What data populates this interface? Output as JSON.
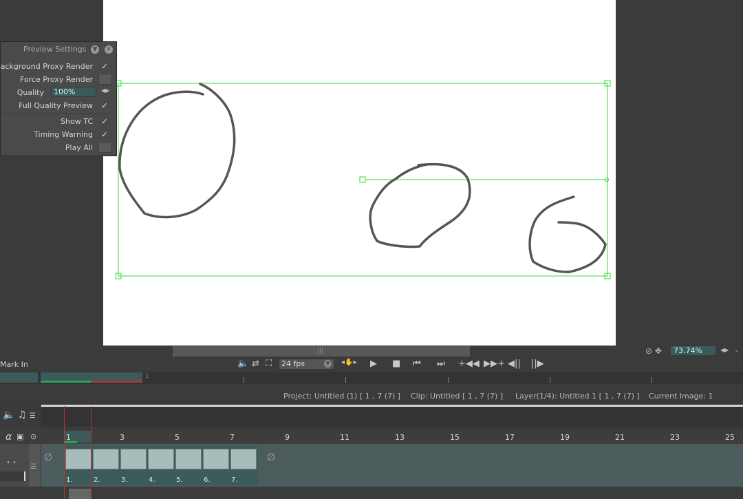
{
  "preview_settings": {
    "title": "Preview Settings",
    "background_proxy_render": {
      "label": "Background Proxy Render",
      "checked": true
    },
    "force_proxy_render": {
      "label": "Force Proxy Render",
      "checked": false
    },
    "quality": {
      "label": "Quality",
      "value": "100%"
    },
    "full_quality_preview": {
      "label": "Full Quality Preview",
      "checked": true
    },
    "show_tc": {
      "label": "Show TC",
      "checked": true
    },
    "timing_warning": {
      "label": "Timing Warning",
      "checked": true
    },
    "play_all": {
      "label": "Play All",
      "checked": false
    }
  },
  "viewer": {
    "zoom": "73.74%",
    "stroke_color": "#555555",
    "selection_color": "#33dd33"
  },
  "transport": {
    "mark_in_label": "Mark In",
    "fps": "24 fps"
  },
  "ruler": {
    "marker": "1"
  },
  "status": {
    "project": "Project: Untitled (1) [ 1 , 7  (7) ]",
    "clip": "Clip: Untitled [ 1 , 7  (7) ]",
    "layer": "Layer(1/4): Untitled 1 [ 1 , 7  (7) ]",
    "current_image": "Current Image: 1"
  },
  "frame_ruler": {
    "numbers": [
      "1",
      "3",
      "5",
      "7",
      "9",
      "11",
      "13",
      "15",
      "17",
      "19",
      "21",
      "23",
      "25"
    ]
  },
  "track": {
    "cells": [
      "1.",
      "2.",
      "3.",
      "4.",
      "5.",
      "6.",
      "7."
    ]
  },
  "colors": {
    "accent_teal": "#3d5a5a",
    "playhead_red": "#b83232",
    "in_green": "#2da35a"
  }
}
